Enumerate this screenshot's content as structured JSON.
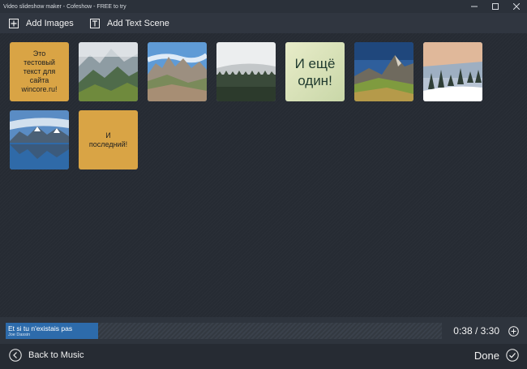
{
  "window": {
    "title": "Video slideshow maker - Cofeshow - FREE to try"
  },
  "toolbar": {
    "add_images_label": "Add Images",
    "add_text_label": "Add Text Scene",
    "add_images_icon": "plus-square-icon",
    "add_text_icon": "text-t-icon"
  },
  "scenes": [
    {
      "type": "text",
      "text": "Это\nтестовый\nтекст для\nсайта\nwincore.ru!",
      "bg": "#d9a445",
      "color": "#222222"
    },
    {
      "type": "image",
      "depicts": "misty green mountain valley"
    },
    {
      "type": "image",
      "depicts": "rocky mountain peaks under blue sky"
    },
    {
      "type": "image",
      "depicts": "pine forest in fog"
    },
    {
      "type": "text",
      "text": "И ещё\nодин!",
      "bg": "#d6e0b8",
      "color": "#1f3a2e"
    },
    {
      "type": "image",
      "depicts": "sunlit mountain meadow"
    },
    {
      "type": "image",
      "depicts": "snowy pine trees at sunset"
    },
    {
      "type": "image",
      "depicts": "mountain lake reflection"
    },
    {
      "type": "text",
      "text": "И\nпоследний!",
      "bg": "#d9a445",
      "color": "#222222"
    }
  ],
  "music": {
    "title": "Et si tu n'existais pas",
    "artist": "Joe Dassin",
    "clip_color": "#2d6bab"
  },
  "timeline": {
    "time": "0:38 / 3:30",
    "add_music_icon": "plus-circle-icon"
  },
  "footer": {
    "back_label": "Back to Music",
    "back_icon": "chevron-left-circle-icon",
    "done_label": "Done",
    "done_icon": "check-circle-icon"
  },
  "colors": {
    "background": "#262b33",
    "toolbar": "#303640",
    "accent": "#2d6bab"
  }
}
